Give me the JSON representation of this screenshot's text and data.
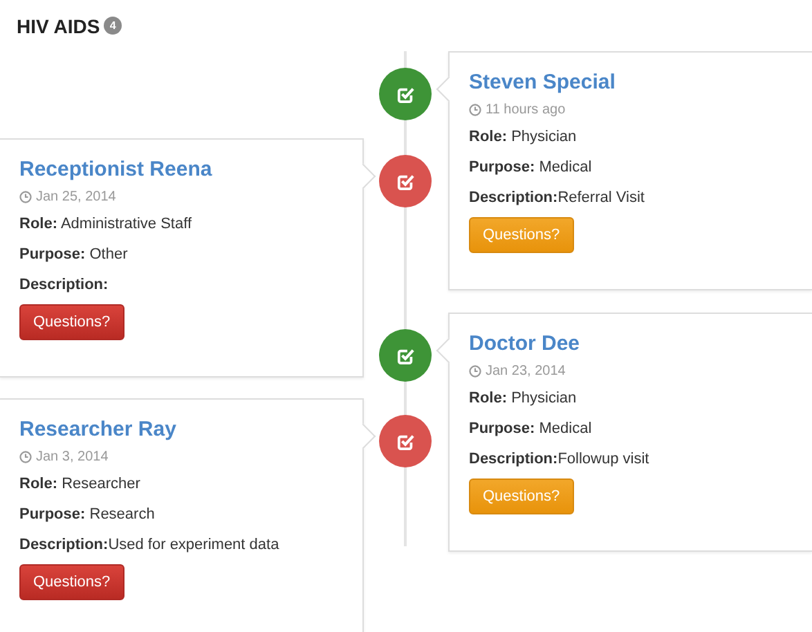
{
  "header": {
    "title": "HIV AIDS",
    "count": "4"
  },
  "entries": [
    {
      "kind": "right",
      "color": "#3e9437",
      "name": "Steven Special",
      "time": "11 hours ago",
      "role_label": "Role:",
      "role": "Physician",
      "purpose_label": "Purpose:",
      "purpose": "Medical",
      "description_label": "Description:",
      "description": "Referral Visit",
      "button": "Questions?"
    },
    {
      "kind": "left",
      "color": "#d9534f",
      "name": "Receptionist Reena",
      "time": "Jan 25, 2014",
      "role_label": "Role:",
      "role": "Administrative Staff",
      "purpose_label": "Purpose:",
      "purpose": "Other",
      "description_label": "Description:",
      "button": "Questions?"
    },
    {
      "kind": "right",
      "color": "#3e9437",
      "name": "Doctor Dee",
      "time": "Jan 23, 2014",
      "role_label": "Role:",
      "role": "Physician",
      "purpose_label": "Purpose:",
      "purpose": "Medical",
      "description_label": "Description:",
      "description": "Followup visit",
      "button": "Questions?"
    },
    {
      "kind": "left",
      "color": "#d9534f",
      "name": "Researcher Ray",
      "time": "Jan 3, 2014",
      "role_label": "Role:",
      "role": "Researcher",
      "purpose_label": "Purpose:",
      "purpose": "Research",
      "description_label": "Description:",
      "description": "Used for experiment data",
      "button": "Questions?"
    }
  ]
}
